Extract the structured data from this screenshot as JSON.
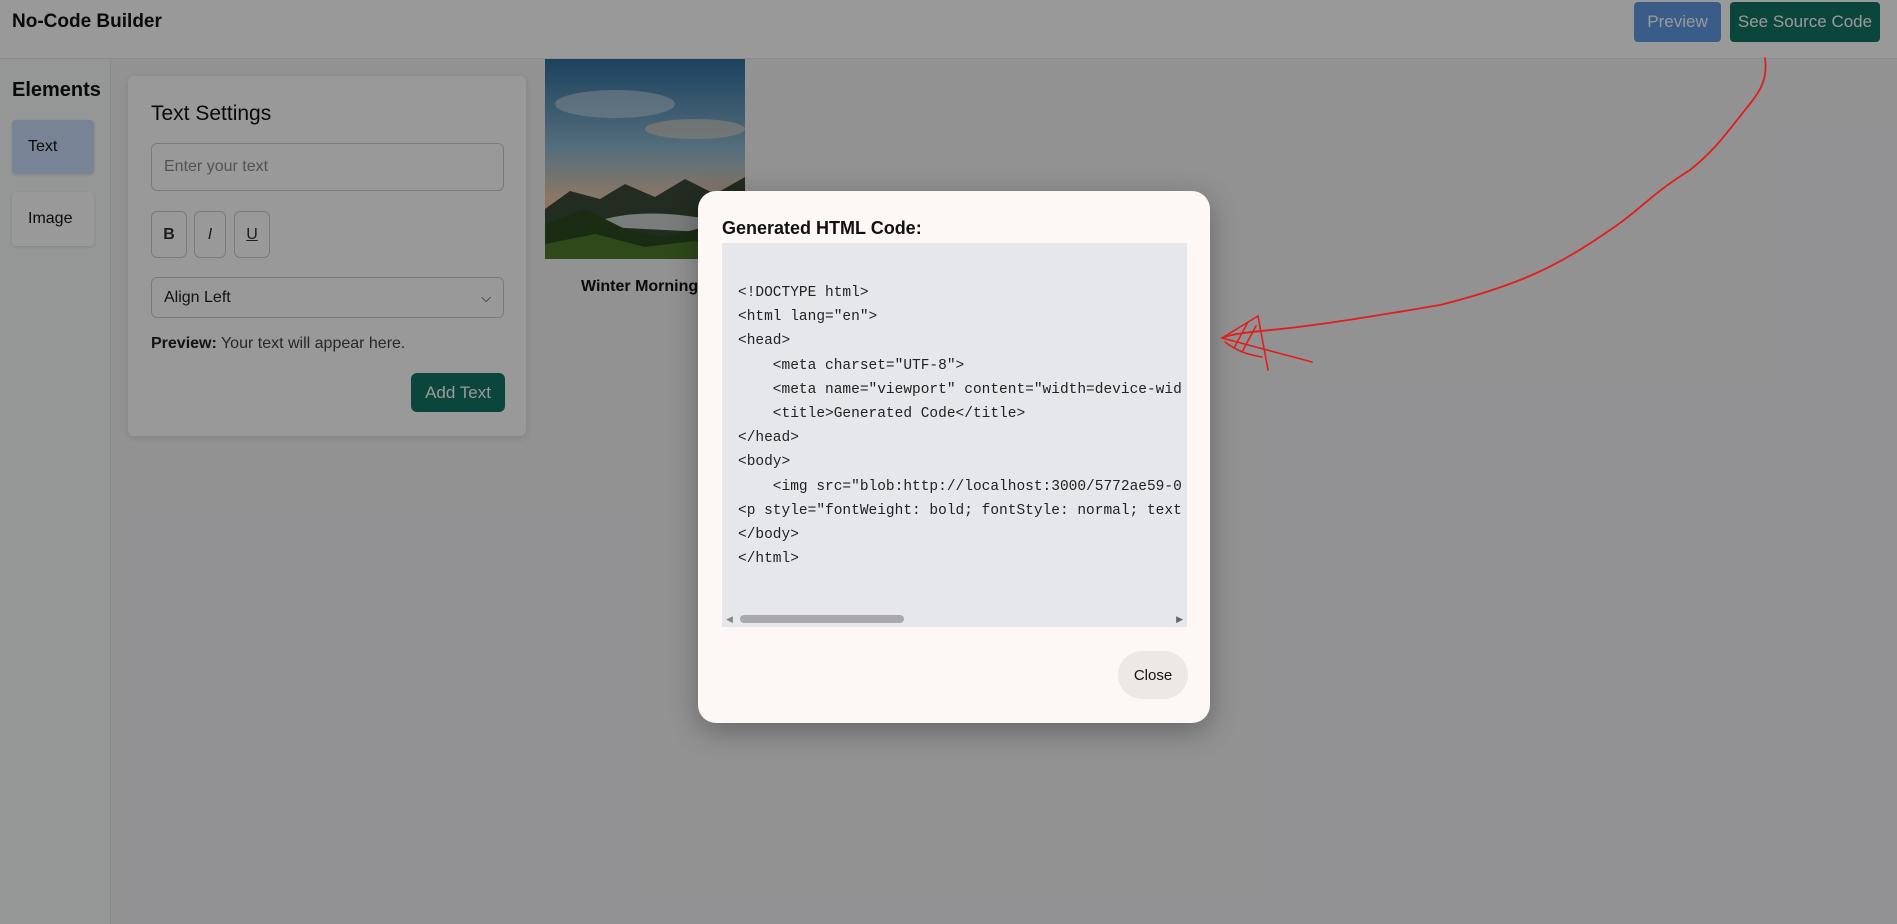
{
  "header": {
    "title": "No-Code Builder",
    "preview_label": "Preview",
    "source_label": "See Source Code"
  },
  "sidebar": {
    "title": "Elements",
    "items": [
      {
        "label": "Text",
        "selected": true
      },
      {
        "label": "Image",
        "selected": false
      }
    ]
  },
  "text_settings": {
    "title": "Text Settings",
    "input_placeholder": "Enter your text",
    "input_value": "",
    "format_buttons": [
      "B",
      "I",
      "U"
    ],
    "align_value": "Align Left",
    "preview_label": "Preview:",
    "preview_text": "Your text will appear here.",
    "add_button": "Add Text"
  },
  "canvas": {
    "image_caption": "Winter Morning"
  },
  "modal": {
    "title": "Generated HTML Code:",
    "code": "<!DOCTYPE html>\n<html lang=\"en\">\n<head>\n    <meta charset=\"UTF-8\">\n    <meta name=\"viewport\" content=\"width=device-wid\n    <title>Generated Code</title>\n</head>\n<body>\n    <img src=\"blob:http://localhost:3000/5772ae59-0\n<p style=\"fontWeight: bold; fontStyle: normal; text\n</body>\n</html>",
    "close_label": "Close"
  },
  "colors": {
    "primary_green": "#137565",
    "preview_blue": "#5f9ae3",
    "annotation_red": "#e11d1d"
  }
}
